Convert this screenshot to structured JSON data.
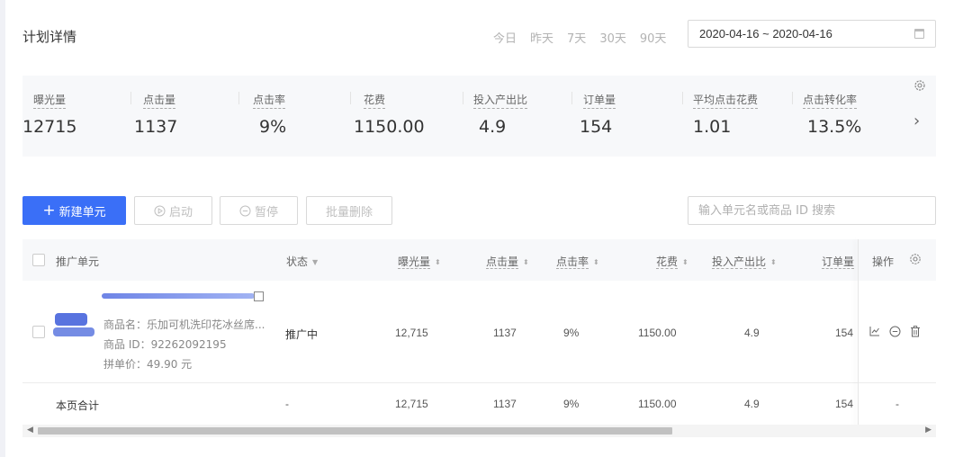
{
  "page": {
    "title": "计划详情"
  },
  "date_filter": {
    "quick_options": [
      "今日",
      "昨天",
      "7天",
      "30天",
      "90天"
    ],
    "range": "2020-04-16 ~ 2020-04-16"
  },
  "metrics": [
    {
      "label": "曝光量",
      "value": "12715"
    },
    {
      "label": "点击量",
      "value": "1137"
    },
    {
      "label": "点击率",
      "value": "9%"
    },
    {
      "label": "花费",
      "value": "1150.00"
    },
    {
      "label": "投入产出比",
      "value": "4.9"
    },
    {
      "label": "订单量",
      "value": "154"
    },
    {
      "label": "平均点击花费",
      "value": "1.01"
    },
    {
      "label": "点击转化率",
      "value": "13.5%"
    }
  ],
  "toolbar": {
    "new_unit": "新建单元",
    "start": "启动",
    "pause": "暂停",
    "bulk_delete": "批量删除",
    "search_placeholder": "输入单元名或商品 ID 搜索"
  },
  "table": {
    "headers": {
      "unit": "推广单元",
      "status": "状态",
      "impressions": "曝光量",
      "clicks": "点击量",
      "ctr": "点击率",
      "cost": "花费",
      "roi": "投入产出比",
      "orders": "订单量",
      "actions": "操作"
    },
    "rows": [
      {
        "product_name": "商品名：乐加可机洗印花冰丝席...",
        "product_id": "商品 ID：92262092195",
        "group_price": "拼单价：49.90 元",
        "status": "推广中",
        "impressions": "12,715",
        "clicks": "1137",
        "ctr": "9%",
        "cost": "1150.00",
        "roi": "4.9",
        "orders": "154"
      }
    ],
    "total": {
      "label": "本页合计",
      "status": "-",
      "impressions": "12,715",
      "clicks": "1137",
      "ctr": "9%",
      "cost": "1150.00",
      "roi": "4.9",
      "orders": "154",
      "actions": "-"
    }
  },
  "colors": {
    "primary": "#3a6ff7",
    "metric_bg": "#f7f8fa",
    "disabled_text": "#c0c0c0"
  }
}
